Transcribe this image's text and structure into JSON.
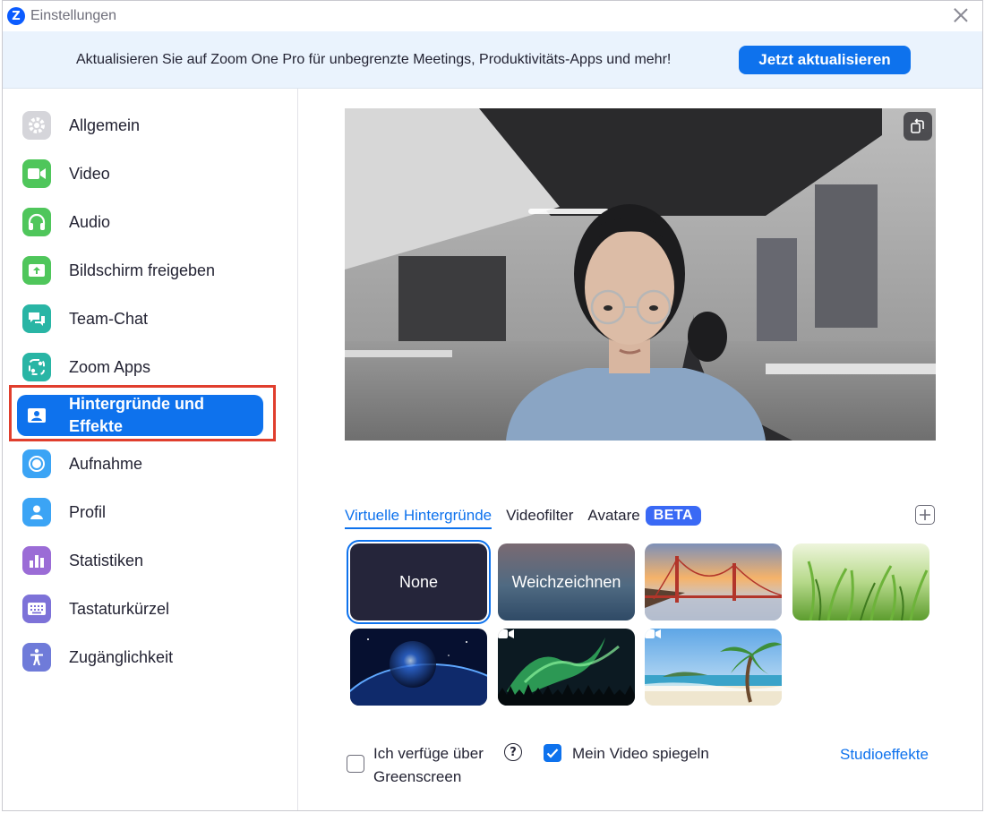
{
  "window": {
    "title": "Einstellungen",
    "logo_letter": "Z"
  },
  "banner": {
    "text": "Aktualisieren Sie auf Zoom One Pro für unbegrenzte Meetings, Produktivitäts-Apps und mehr!",
    "button_label": "Jetzt aktualisieren"
  },
  "sidebar": {
    "items": [
      {
        "label": "Allgemein",
        "icon": "gear-icon",
        "color": "#c9c9cf"
      },
      {
        "label": "Video",
        "icon": "video-camera-icon",
        "color": "#4fc65b"
      },
      {
        "label": "Audio",
        "icon": "headphones-icon",
        "color": "#4fc65b"
      },
      {
        "label": "Bildschirm freigeben",
        "icon": "share-screen-icon",
        "color": "#4fc65b"
      },
      {
        "label": "Team-Chat",
        "icon": "chat-bubble-icon",
        "color": "#29b5a5"
      },
      {
        "label": "Zoom Apps",
        "icon": "apps-icon",
        "color": "#29b5a5"
      },
      {
        "label": "Hintergründe und Effekte",
        "icon": "portrait-icon",
        "color": "#0e72ed",
        "active": true
      },
      {
        "label": "Aufnahme",
        "icon": "record-icon",
        "color": "#3ba4f5"
      },
      {
        "label": "Profil",
        "icon": "user-icon",
        "color": "#3ba4f5"
      },
      {
        "label": "Statistiken",
        "icon": "statistics-icon",
        "color": "#9b6cd6"
      },
      {
        "label": "Tastaturkürzel",
        "icon": "keyboard-icon",
        "color": "#7d72d8"
      },
      {
        "label": "Zugänglichkeit",
        "icon": "accessibility-icon",
        "color": "#6f7bd9"
      }
    ]
  },
  "tabs": [
    {
      "label": "Virtuelle Hintergründe",
      "active": true
    },
    {
      "label": "Videofilter"
    },
    {
      "label": "Avatare"
    }
  ],
  "beta_badge": "BETA",
  "backgrounds": [
    {
      "label": "None",
      "selected": true
    },
    {
      "label": "Weichzeichnen"
    },
    {
      "label": "",
      "icon": "golden-gate-bridge"
    },
    {
      "label": "",
      "icon": "green-grass"
    },
    {
      "label": "",
      "icon": "earth-from-space"
    },
    {
      "label": "",
      "icon": "northern-lights",
      "video": true
    },
    {
      "label": "",
      "icon": "palm-beach",
      "video": true
    }
  ],
  "footer": {
    "greenscreen_label": "Ich verfüge über Greenscreen",
    "greenscreen_label_line1": "Ich verfüge über",
    "greenscreen_label_line2": "Greenscreen",
    "greenscreen_checked": false,
    "help_glyph": "?",
    "mirror_label": "Mein Video spiegeln",
    "mirror_checked": true,
    "studio_link": "Studioeffekte"
  },
  "colors": {
    "accent": "#0e72ed",
    "banner_bg": "#eaf3fd",
    "highlight": "#e03e2d"
  }
}
